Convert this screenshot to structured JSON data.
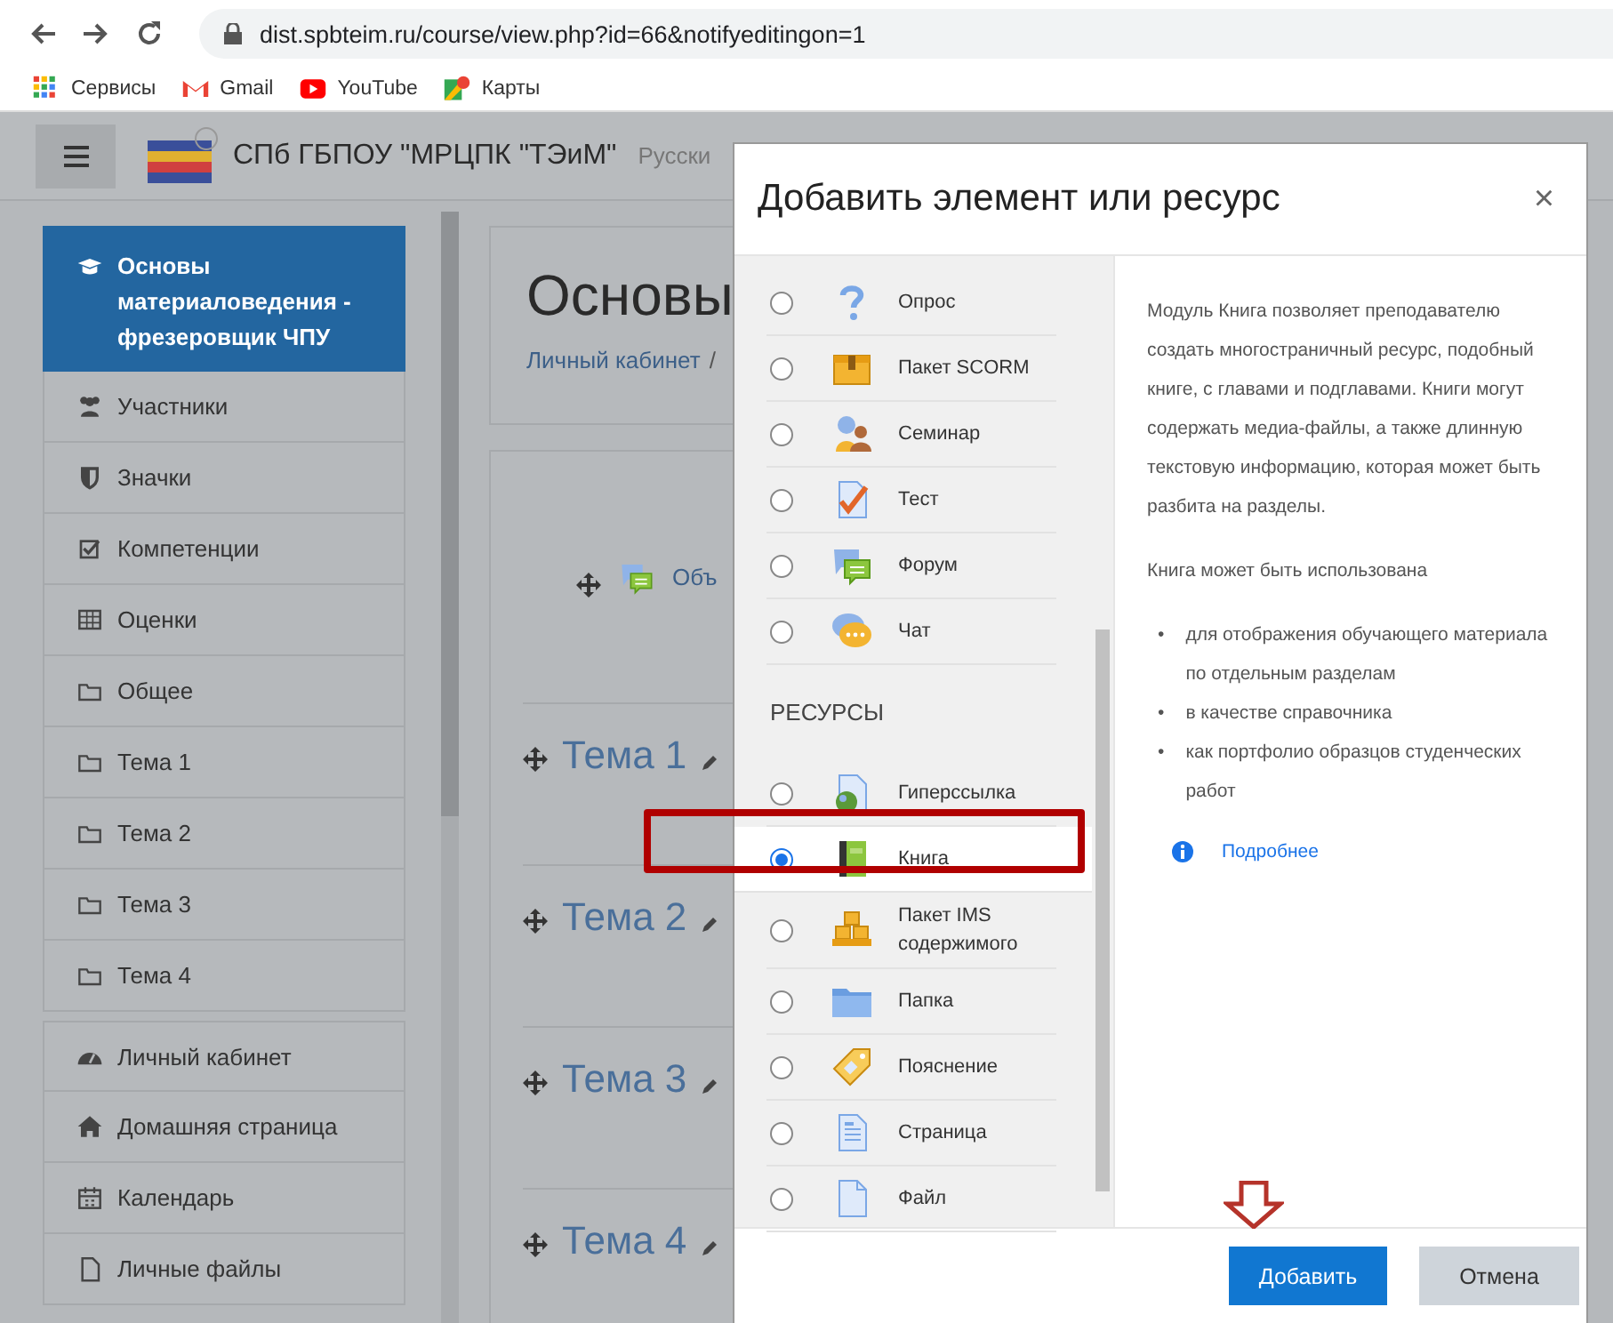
{
  "browser": {
    "address": "dist.spbteim.ru/course/view.php?id=66&notifyeditingon=1",
    "bookmarks": [
      {
        "label": "Сервисы",
        "kind": "apps"
      },
      {
        "label": "Gmail",
        "kind": "gmail"
      },
      {
        "label": "YouTube",
        "kind": "youtube"
      },
      {
        "label": "Карты",
        "kind": "maps"
      }
    ]
  },
  "navbar": {
    "site_name": "СПб ГБПОУ \"МРЦПК \"ТЭиМ\"",
    "language": "Русски"
  },
  "sidebar": {
    "blocks": [
      [
        {
          "label": "Основы материаловедения - фрезеровщик ЧПУ",
          "kind": "course",
          "selected": true
        },
        {
          "label": "Участники",
          "kind": "users",
          "selected": false
        },
        {
          "label": "Значки",
          "kind": "shield",
          "selected": false
        },
        {
          "label": "Компетенции",
          "kind": "check",
          "selected": false
        },
        {
          "label": "Оценки",
          "kind": "table",
          "selected": false
        },
        {
          "label": "Общее",
          "kind": "folder",
          "selected": false
        },
        {
          "label": "Тема 1",
          "kind": "folder",
          "selected": false
        },
        {
          "label": "Тема 2",
          "kind": "folder",
          "selected": false
        },
        {
          "label": "Тема 3",
          "kind": "folder",
          "selected": false
        },
        {
          "label": "Тема 4",
          "kind": "folder",
          "selected": false
        }
      ],
      [
        {
          "label": "Личный кабинет",
          "kind": "gauge",
          "selected": false
        },
        {
          "label": "Домашняя страница",
          "kind": "home",
          "selected": false
        },
        {
          "label": "Календарь",
          "kind": "calendar",
          "selected": false
        },
        {
          "label": "Личные файлы",
          "kind": "file",
          "selected": false
        }
      ]
    ]
  },
  "main": {
    "title": "Основы",
    "breadcrumb": "Личный кабинет",
    "breadcrumb_separator": "/",
    "announcement": "Объ",
    "sections": [
      "Тема 1",
      "Тема 2",
      "Тема 3",
      "Тема 4"
    ]
  },
  "modal": {
    "title": "Добавить элемент или ресурс",
    "close": "×",
    "groups": [
      {
        "items": [
          {
            "label": "Опрос",
            "kind": "question",
            "selected": false
          },
          {
            "label": "Пакет SCORM",
            "kind": "package",
            "selected": false
          },
          {
            "label": "Семинар",
            "kind": "people",
            "selected": false
          },
          {
            "label": "Тест",
            "kind": "test",
            "selected": false
          },
          {
            "label": "Форум",
            "kind": "forum",
            "selected": false
          },
          {
            "label": "Чат",
            "kind": "chat",
            "selected": false
          }
        ]
      },
      {
        "heading": "РЕСУРСЫ",
        "items": [
          {
            "label": "Гиперссылка",
            "kind": "url",
            "selected": false
          },
          {
            "label": "Книга",
            "kind": "book",
            "selected": true
          },
          {
            "label": "Пакет IMS содержимого",
            "kind": "boxes",
            "selected": false
          },
          {
            "label": "Папка",
            "kind": "folder",
            "selected": false
          },
          {
            "label": "Пояснение",
            "kind": "tag",
            "selected": false
          },
          {
            "label": "Страница",
            "kind": "page",
            "selected": false
          },
          {
            "label": "Файл",
            "kind": "file",
            "selected": false
          }
        ]
      }
    ],
    "description": {
      "paragraphs": [
        "Модуль Книга позволяет преподавателю создать многостраничный ресурс, подобный книге, с главами и подглавами. Книги могут содержать медиа-файлы, а также длинную текстовую информацию, которая может быть разбита на разделы.",
        "Книга может быть использована"
      ],
      "bullet_marker": "•",
      "bullets": [
        "для отображения обучающего материала по отдельным разделам",
        "в качестве справочника",
        "как портфолио образцов студенческих работ"
      ],
      "more_link": "Подробнее"
    },
    "buttons": [
      {
        "label": "Добавить",
        "kind": "primary"
      },
      {
        "label": "Отмена",
        "kind": "secondary"
      }
    ]
  }
}
